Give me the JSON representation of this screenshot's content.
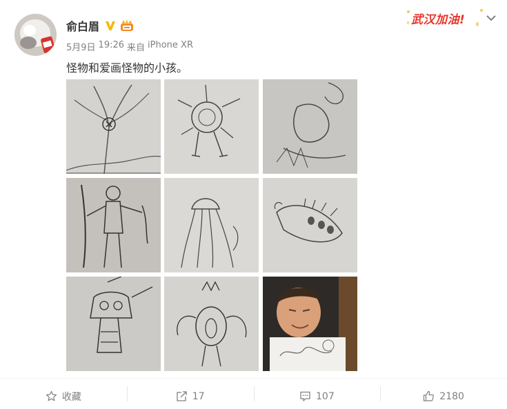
{
  "post": {
    "author": "俞白眉",
    "date": "5月9日",
    "time": "19:26",
    "source_prefix": "来自",
    "device": "iPhone XR",
    "text": "怪物和爱画怪物的小孩。"
  },
  "campaign_badge": {
    "text": "武汉加油!"
  },
  "photos": [
    "drawing-tree-monster",
    "drawing-spiky-creature",
    "drawing-dragon",
    "drawing-warrior",
    "drawing-jellyfish",
    "drawing-caterpillar",
    "drawing-robot-monster",
    "drawing-squid-monster",
    "photo-child-with-drawing"
  ],
  "actions": {
    "favorite": {
      "label": "收藏",
      "icon": "star-icon"
    },
    "repost": {
      "count": "17",
      "icon": "repost-icon"
    },
    "comment": {
      "count": "107",
      "icon": "comment-icon"
    },
    "like": {
      "count": "2180",
      "icon": "thumbs-up-icon"
    }
  },
  "colors": {
    "verified": "#f7b500",
    "campaign_red": "#e8352b",
    "meta_gray": "#808080"
  }
}
